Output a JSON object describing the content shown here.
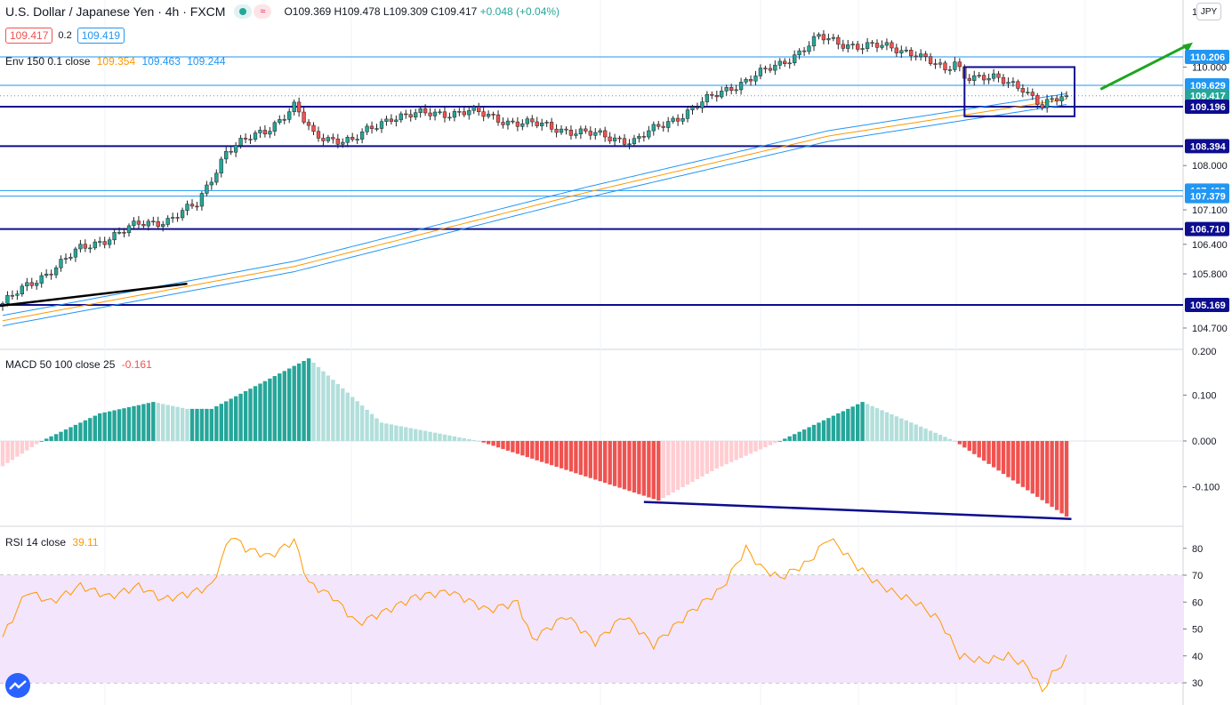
{
  "header": {
    "symbol": "U.S. Dollar / Japanese Yen · 4h · FXCM",
    "ohlc": "O109.369 H109.478 L109.309 C109.417",
    "change": "+0.048 (+0.04%)",
    "bid": "109.417",
    "spread": "0.2",
    "ask": "109.419",
    "currency": "JPY"
  },
  "indicators": {
    "env_label": "Env 150 0.1 close",
    "env_mid": "109.354",
    "env_upper": "109.463",
    "env_lower": "109.244",
    "macd_label": "MACD 50 100 close 25",
    "macd_value": "-0.161",
    "rsi_label": "RSI 14 close",
    "rsi_value": "39.11"
  },
  "colors": {
    "up": "#26a69a",
    "down": "#ef5350",
    "level_dark": "#0d0d8f",
    "level_light": "#2196f3",
    "env_mid": "#ff9800",
    "rsi": "#ff9800",
    "rsi_band": "#f3e5fb",
    "arrow": "#1fa51f"
  },
  "chart_data": [
    {
      "type": "candlestick",
      "title": "U.S. Dollar / Japanese Yen · 4h · FXCM",
      "ylim": [
        104.5,
        110.6
      ],
      "y_ticks": [
        "104.700",
        "105.800",
        "106.400",
        "107.100",
        "108.000",
        "110.000"
      ],
      "partial_ticks": [
        "1"
      ],
      "price_labels": [
        {
          "value": 110.206,
          "text": "110.206",
          "style": "light"
        },
        {
          "value": 109.629,
          "text": "109.629",
          "style": "light"
        },
        {
          "value": 109.417,
          "text": "109.417",
          "style": "current"
        },
        {
          "value": 109.196,
          "text": "109.196",
          "style": "dark"
        },
        {
          "value": 108.394,
          "text": "108.394",
          "style": "dark"
        },
        {
          "value": 107.492,
          "text": "107.492",
          "style": "light"
        },
        {
          "value": 107.379,
          "text": "107.379",
          "style": "light"
        },
        {
          "value": 106.71,
          "text": "106.710",
          "style": "dark"
        },
        {
          "value": 105.169,
          "text": "105.169",
          "style": "dark"
        }
      ],
      "key_points": [
        {
          "bar": 0,
          "close": 105.2
        },
        {
          "bar": 16,
          "close": 106.3
        },
        {
          "bar": 28,
          "close": 106.8
        },
        {
          "bar": 34,
          "close": 106.9
        },
        {
          "bar": 40,
          "close": 107.2
        },
        {
          "bar": 46,
          "close": 108.3
        },
        {
          "bar": 54,
          "close": 108.7
        },
        {
          "bar": 60,
          "close": 109.2
        },
        {
          "bar": 64,
          "close": 108.6
        },
        {
          "bar": 72,
          "close": 108.5
        },
        {
          "bar": 80,
          "close": 109.0
        },
        {
          "bar": 96,
          "close": 109.1
        },
        {
          "bar": 104,
          "close": 108.9
        },
        {
          "bar": 112,
          "close": 108.8
        },
        {
          "bar": 120,
          "close": 108.65
        },
        {
          "bar": 130,
          "close": 108.5
        },
        {
          "bar": 140,
          "close": 109.05
        },
        {
          "bar": 150,
          "close": 109.6
        },
        {
          "bar": 160,
          "close": 110.05
        },
        {
          "bar": 168,
          "close": 110.6
        },
        {
          "bar": 172,
          "close": 110.48
        },
        {
          "bar": 180,
          "close": 110.42
        },
        {
          "bar": 188,
          "close": 110.3
        },
        {
          "bar": 194,
          "close": 109.9
        },
        {
          "bar": 196,
          "close": 110.1
        },
        {
          "bar": 198,
          "close": 109.85
        },
        {
          "bar": 204,
          "close": 109.75
        },
        {
          "bar": 210,
          "close": 109.6
        },
        {
          "bar": 214,
          "close": 109.2
        },
        {
          "bar": 219,
          "close": 109.42
        }
      ],
      "envelope_points": [
        {
          "bar": 0,
          "mid": 104.85
        },
        {
          "bar": 60,
          "mid": 105.95
        },
        {
          "bar": 120,
          "mid": 107.45
        },
        {
          "bar": 170,
          "mid": 108.6
        },
        {
          "bar": 219,
          "mid": 109.35
        }
      ]
    },
    {
      "type": "bar",
      "title": "MACD 50 100 close 25",
      "ylim": [
        -0.2,
        0.2
      ],
      "y_ticks": [
        "0.100",
        "0.000",
        "-0.100"
      ],
      "partial_ticks": [
        "0.200"
      ],
      "key_points": [
        {
          "bar": 0,
          "value": -0.055
        },
        {
          "bar": 8,
          "value": 0.0
        },
        {
          "bar": 20,
          "value": 0.06
        },
        {
          "bar": 31,
          "value": 0.085
        },
        {
          "bar": 38,
          "value": 0.07
        },
        {
          "bar": 43,
          "value": 0.07
        },
        {
          "bar": 63,
          "value": 0.18
        },
        {
          "bar": 78,
          "value": 0.04
        },
        {
          "bar": 98,
          "value": 0.0
        },
        {
          "bar": 135,
          "value": -0.13
        },
        {
          "bar": 147,
          "value": -0.06
        },
        {
          "bar": 160,
          "value": 0.0
        },
        {
          "bar": 177,
          "value": 0.085
        },
        {
          "bar": 196,
          "value": 0.0
        },
        {
          "bar": 219,
          "value": -0.165
        }
      ]
    },
    {
      "type": "line",
      "title": "RSI 14 close",
      "ylim": [
        25,
        90
      ],
      "y_ticks": [
        "80",
        "70",
        "60",
        "50",
        "40",
        "30"
      ],
      "band": [
        30,
        70
      ],
      "key_points": [
        {
          "bar": 0,
          "value": 47
        },
        {
          "bar": 5,
          "value": 64
        },
        {
          "bar": 10,
          "value": 60
        },
        {
          "bar": 16,
          "value": 66
        },
        {
          "bar": 22,
          "value": 62
        },
        {
          "bar": 28,
          "value": 66
        },
        {
          "bar": 33,
          "value": 61
        },
        {
          "bar": 38,
          "value": 63
        },
        {
          "bar": 43,
          "value": 66
        },
        {
          "bar": 47,
          "value": 85
        },
        {
          "bar": 50,
          "value": 80
        },
        {
          "bar": 55,
          "value": 77
        },
        {
          "bar": 60,
          "value": 83
        },
        {
          "bar": 63,
          "value": 67
        },
        {
          "bar": 68,
          "value": 62
        },
        {
          "bar": 73,
          "value": 52
        },
        {
          "bar": 78,
          "value": 56
        },
        {
          "bar": 85,
          "value": 62
        },
        {
          "bar": 92,
          "value": 64
        },
        {
          "bar": 100,
          "value": 57
        },
        {
          "bar": 106,
          "value": 60
        },
        {
          "bar": 109,
          "value": 46
        },
        {
          "bar": 116,
          "value": 55
        },
        {
          "bar": 122,
          "value": 45
        },
        {
          "bar": 128,
          "value": 55
        },
        {
          "bar": 134,
          "value": 44
        },
        {
          "bar": 137,
          "value": 49
        },
        {
          "bar": 142,
          "value": 57
        },
        {
          "bar": 148,
          "value": 65
        },
        {
          "bar": 153,
          "value": 80
        },
        {
          "bar": 156,
          "value": 73
        },
        {
          "bar": 160,
          "value": 69
        },
        {
          "bar": 166,
          "value": 75
        },
        {
          "bar": 170,
          "value": 84
        },
        {
          "bar": 173,
          "value": 79
        },
        {
          "bar": 176,
          "value": 73
        },
        {
          "bar": 180,
          "value": 67
        },
        {
          "bar": 184,
          "value": 63
        },
        {
          "bar": 188,
          "value": 60
        },
        {
          "bar": 193,
          "value": 53
        },
        {
          "bar": 197,
          "value": 40
        },
        {
          "bar": 202,
          "value": 38
        },
        {
          "bar": 207,
          "value": 40
        },
        {
          "bar": 211,
          "value": 36
        },
        {
          "bar": 214,
          "value": 27
        },
        {
          "bar": 216,
          "value": 33
        },
        {
          "bar": 219,
          "value": 39
        }
      ]
    }
  ]
}
